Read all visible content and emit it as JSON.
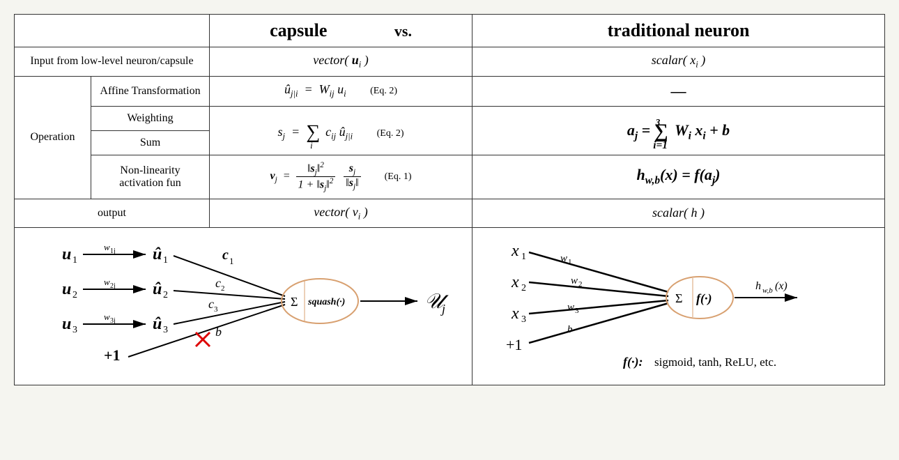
{
  "header": {
    "col1": "",
    "col2_left": "capsule",
    "col2_vs": "vs.",
    "col2_right": "traditional neuron"
  },
  "rows": {
    "input": {
      "label": "Input from low-level neuron/capsule",
      "capsule": "vector( uᵢ )",
      "neuron": "scalar( xᵢ )"
    },
    "operation_label": "Operation",
    "affine": {
      "label": "Affine Transformation",
      "capsule_eq": "ûⱼ|ᵢ = Wᵢⱼ uᵢ",
      "capsule_eqnum": "(Eq. 2)",
      "neuron": "—"
    },
    "weighting": {
      "label": "Weighting",
      "capsule_eq": "sⱼ = Σᵢ cᵢⱼ ûⱼ|ᵢ",
      "capsule_eqnum": "(Eq. 2)"
    },
    "sum": {
      "label": "Sum",
      "neuron_eq": "aⱼ = Σᵢ₌₁³ Wᵢ xᵢ + b"
    },
    "nonlin": {
      "label": "Non-linearity activation fun",
      "capsule_eq_v": "vⱼ =",
      "capsule_frac1_num": "‖sⱼ‖²",
      "capsule_frac1_den": "1 + ‖sⱼ‖²",
      "capsule_frac2_num": "sⱼ",
      "capsule_frac2_den": "‖sⱼ‖",
      "capsule_eqnum": "(Eq. 1)",
      "neuron_eq": "h_w,b(x) = f(aⱼ)"
    },
    "output": {
      "label": "output",
      "capsule": "vector( vᵢ )",
      "neuron": "scalar( h )"
    }
  },
  "diagram_capsule": {
    "u1": "u₁",
    "u2": "u₂",
    "u3": "u₃",
    "plus1": "+1",
    "w1": "w₁ⱼ",
    "w2": "w₂ⱼ",
    "w3": "w₃ⱼ",
    "uh1": "û₁",
    "uh2": "û₂",
    "uh3": "û₃",
    "c1": "c₁",
    "c2": "c₂",
    "c3": "c₃",
    "b": "b",
    "sigma": "Σ",
    "squash": "squash(·)",
    "out": "𝒰ⱼ"
  },
  "diagram_neuron": {
    "x1": "x₁",
    "x2": "x₂",
    "x3": "x₃",
    "plus1": "+1",
    "w1": "w₁",
    "w2": "w₂",
    "w3": "w₃",
    "b": "b",
    "sigma": "Σ",
    "f": "f(·)",
    "out": "h_w,b(x)",
    "note": "f(·): sigmoid, tanh, ReLU, etc."
  }
}
